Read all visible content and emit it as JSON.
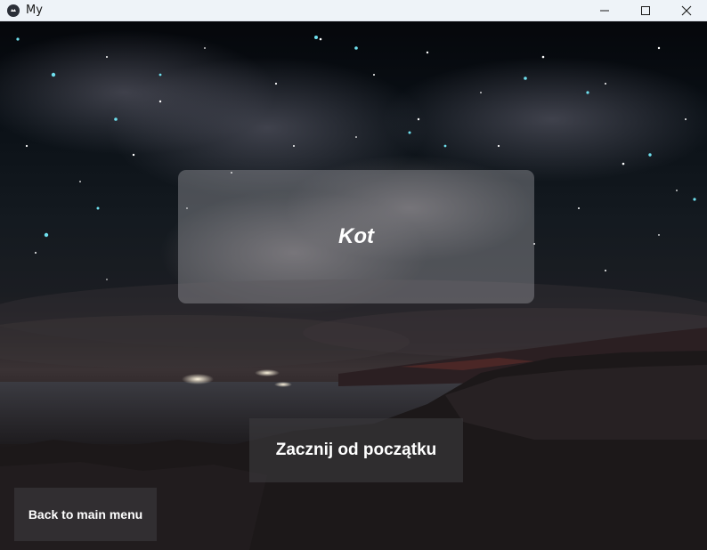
{
  "window": {
    "title": "My"
  },
  "card": {
    "word": "Kot"
  },
  "buttons": {
    "start_label": "Zacznij od początku",
    "back_label": "Back to main menu"
  }
}
